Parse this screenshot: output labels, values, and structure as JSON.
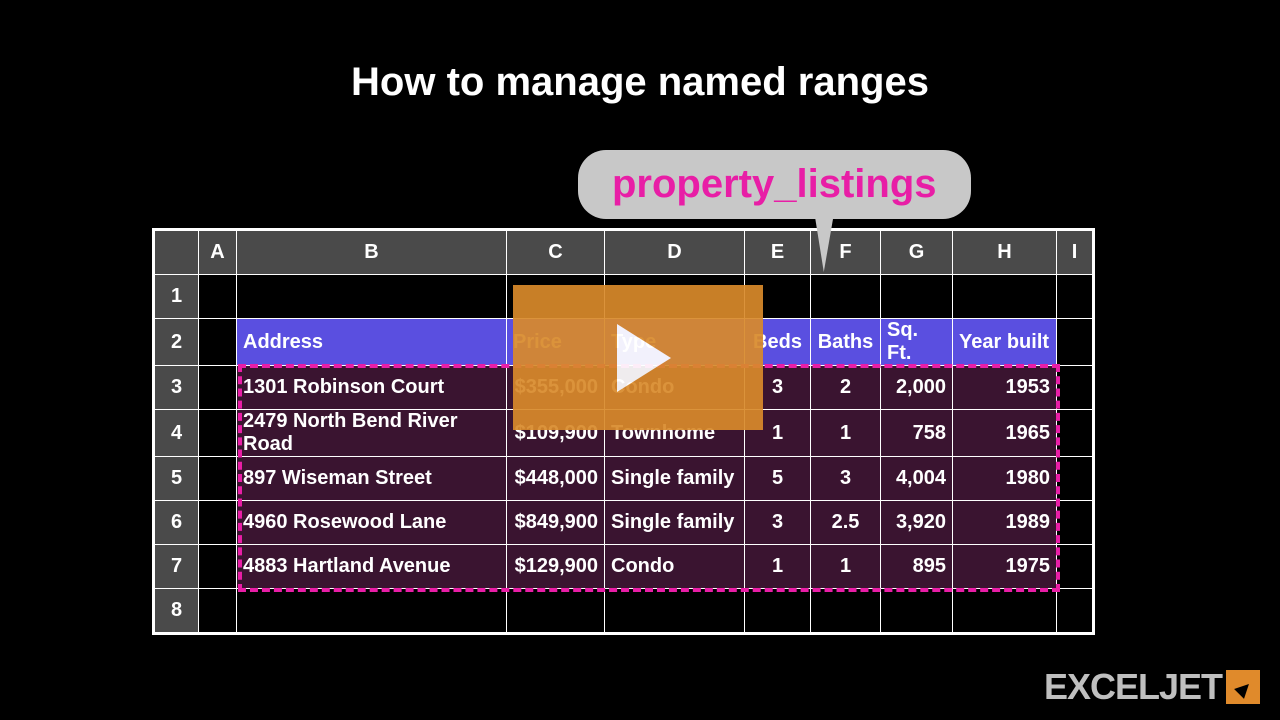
{
  "title": "How to manage named ranges",
  "callout": "property_listings",
  "columns": [
    "A",
    "B",
    "C",
    "D",
    "E",
    "F",
    "G",
    "H",
    "I"
  ],
  "row_numbers": [
    "1",
    "2",
    "3",
    "4",
    "5",
    "6",
    "7",
    "8"
  ],
  "headers": {
    "address": "Address",
    "price": "Price",
    "type": "Type",
    "beds": "Beds",
    "baths": "Baths",
    "sqft": "Sq. Ft.",
    "year": "Year built"
  },
  "rows": [
    {
      "address": "1301 Robinson Court",
      "price": "$355,000",
      "type": "Condo",
      "beds": "3",
      "baths": "2",
      "sqft": "2,000",
      "year": "1953"
    },
    {
      "address": "2479 North Bend River Road",
      "price": "$109,900",
      "type": "Townhome",
      "beds": "1",
      "baths": "1",
      "sqft": "758",
      "year": "1965"
    },
    {
      "address": "897 Wiseman Street",
      "price": "$448,000",
      "type": "Single family",
      "beds": "5",
      "baths": "3",
      "sqft": "4,004",
      "year": "1980"
    },
    {
      "address": "4960 Rosewood Lane",
      "price": "$849,900",
      "type": "Single family",
      "beds": "3",
      "baths": "2.5",
      "sqft": "3,920",
      "year": "1989"
    },
    {
      "address": "4883 Hartland Avenue",
      "price": "$129,900",
      "type": "Condo",
      "beds": "1",
      "baths": "1",
      "sqft": "895",
      "year": "1975"
    }
  ],
  "logo": "EXCELJET"
}
